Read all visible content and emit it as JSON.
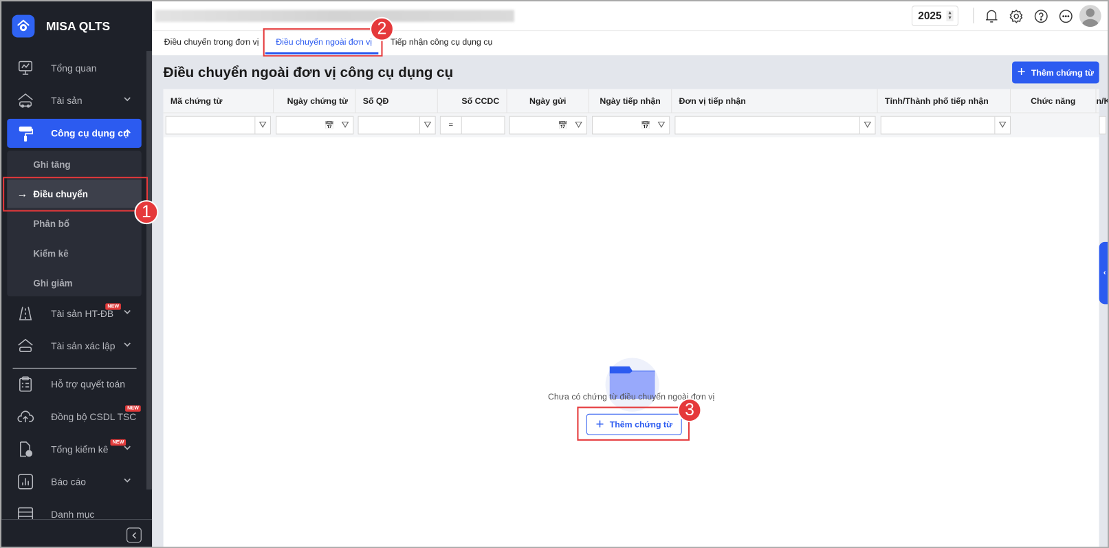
{
  "app": {
    "brand": "MISA QLTS"
  },
  "sidebar": {
    "items": [
      {
        "label": "Tổng quan",
        "icon": "monitor-chart-icon"
      },
      {
        "label": "Tài sản",
        "icon": "house-car-icon"
      },
      {
        "label": "Công cụ dụng cụ",
        "icon": "paint-roller-icon"
      },
      {
        "label": "Tài sản HT-ĐB",
        "icon": "road-icon",
        "badge": "NEW"
      },
      {
        "label": "Tài sản xác lập",
        "icon": "house-car-icon"
      },
      {
        "label": "Hỗ trợ quyết toán",
        "icon": "clipboard-icon"
      },
      {
        "label": "Đồng bộ CSDL TSC",
        "icon": "cloud-upload-icon",
        "badge": "NEW"
      },
      {
        "label": "Tổng kiểm kê",
        "icon": "document-check-icon",
        "badge": "NEW"
      },
      {
        "label": "Báo cáo",
        "icon": "bar-chart-icon"
      },
      {
        "label": "Danh mục",
        "icon": "list-icon"
      }
    ],
    "sub_items": [
      "Ghi tăng",
      "Điều chuyển",
      "Phân bổ",
      "Kiểm kê",
      "Ghi giảm"
    ]
  },
  "header": {
    "year": "2025"
  },
  "tabs": [
    "Điều chuyển trong đơn vị",
    "Điều chuyển ngoài đơn vị",
    "Tiếp nhận công cụ dụng cụ"
  ],
  "main": {
    "title": "Điều chuyển ngoài đơn vị công cụ dụng cụ",
    "add_label": "Thêm chứng từ",
    "columns": [
      "Mã chứng từ",
      "Ngày chứng từ",
      "Số QĐ",
      "Số CCDC",
      "Ngày gửi",
      "Ngày tiếp nhận",
      "Đơn vị tiếp nhận",
      "Tỉnh/Thành phố tiếp nhận",
      "Chức năng",
      "n/K"
    ],
    "number_filter_op": "=",
    "empty_text": "Chưa có chứng từ điều chuyển ngoài đơn vị",
    "empty_button": "Thêm chứng từ"
  },
  "annotations": [
    "1",
    "2",
    "3"
  ],
  "colors": {
    "accent": "#2c5bf0",
    "sidebar": "#1e2129",
    "annotation": "#e5393b"
  }
}
